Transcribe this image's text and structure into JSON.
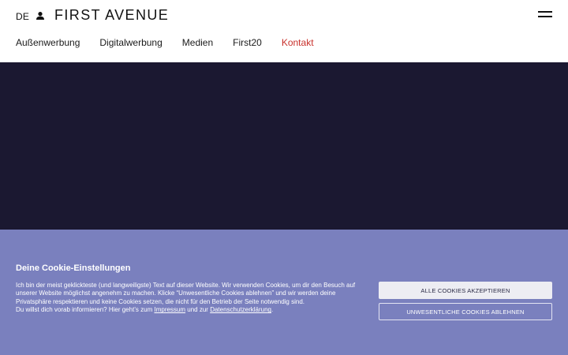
{
  "header": {
    "lang": "DE",
    "logo": "FIRST AVENUE",
    "nav": [
      "Außenwerbung",
      "Digitalwerbung",
      "Medien",
      "First20",
      "Kontakt"
    ]
  },
  "cookie": {
    "title": "Deine Cookie-Einstellungen",
    "text_1": "Ich bin der meist geklickteste (und langweiligste) Text auf dieser Website. Wir verwenden Cookies, um dir den Besuch auf unserer Website möglichst angenehm zu machen. Klicke “Unwesentliche Cookies ablehnen” und wir werden deine Privatsphäre respektieren und keine Cookies setzen, die nicht für den Betrieb der Seite notwendig sind.",
    "text_2": "Du willst dich vorab informieren? Hier geht’s zum ",
    "link_impressum": "Impressum",
    "text_3": " und zur ",
    "link_privacy": "Datenschutzerklärung",
    "text_4": ".",
    "accept_label": "ALLE COOKIES AKZEPTIEREN",
    "decline_label": "UNWESENTLICHE COOKIES ABLEHNEN"
  },
  "colors": {
    "hero": "#1b1831",
    "cookie_bg": "#7a80be",
    "active_nav": "#c8302b"
  },
  "icons": [
    "user-icon",
    "hamburger-menu-icon"
  ]
}
